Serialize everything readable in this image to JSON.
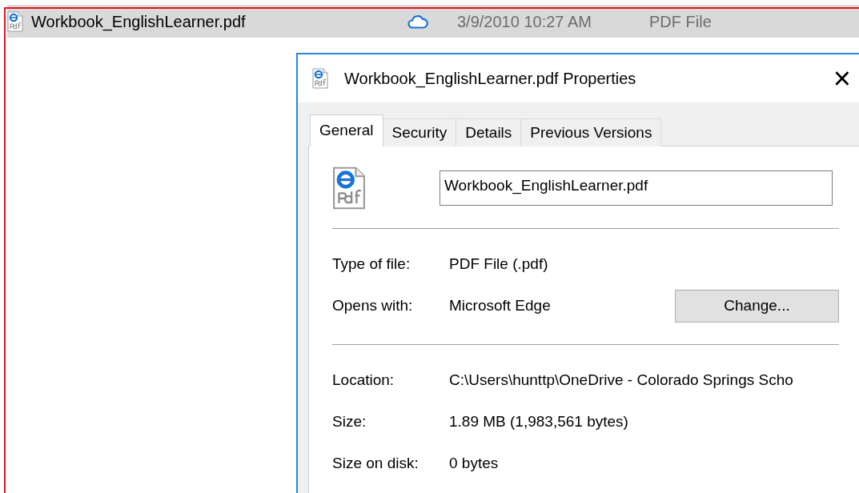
{
  "file_row": {
    "name": "Workbook_EnglishLearner.pdf",
    "date_modified": "3/9/2010 10:27 AM",
    "type": "PDF File",
    "selected": true
  },
  "dialog": {
    "title": "Workbook_EnglishLearner.pdf Properties",
    "close": "×",
    "tabs": [
      {
        "label": "General",
        "selected": true
      },
      {
        "label": "Security",
        "selected": false
      },
      {
        "label": "Details",
        "selected": false
      },
      {
        "label": "Previous Versions",
        "selected": false
      }
    ],
    "file_name": "Workbook_EnglishLearner.pdf",
    "sections": [
      [
        {
          "label": "Type of file:",
          "value": "PDF File (.pdf)"
        },
        {
          "label": "Opens with:",
          "value": "Microsoft Edge",
          "action": "Change..."
        }
      ],
      [
        {
          "label": "Location:",
          "value": "C:\\Users\\hunttp\\OneDrive - Colorado Springs Scho"
        },
        {
          "label": "Size:",
          "value": "1.89 MB (1,983,561 bytes)"
        },
        {
          "label": "Size on disk:",
          "value": "0 bytes"
        }
      ]
    ]
  }
}
